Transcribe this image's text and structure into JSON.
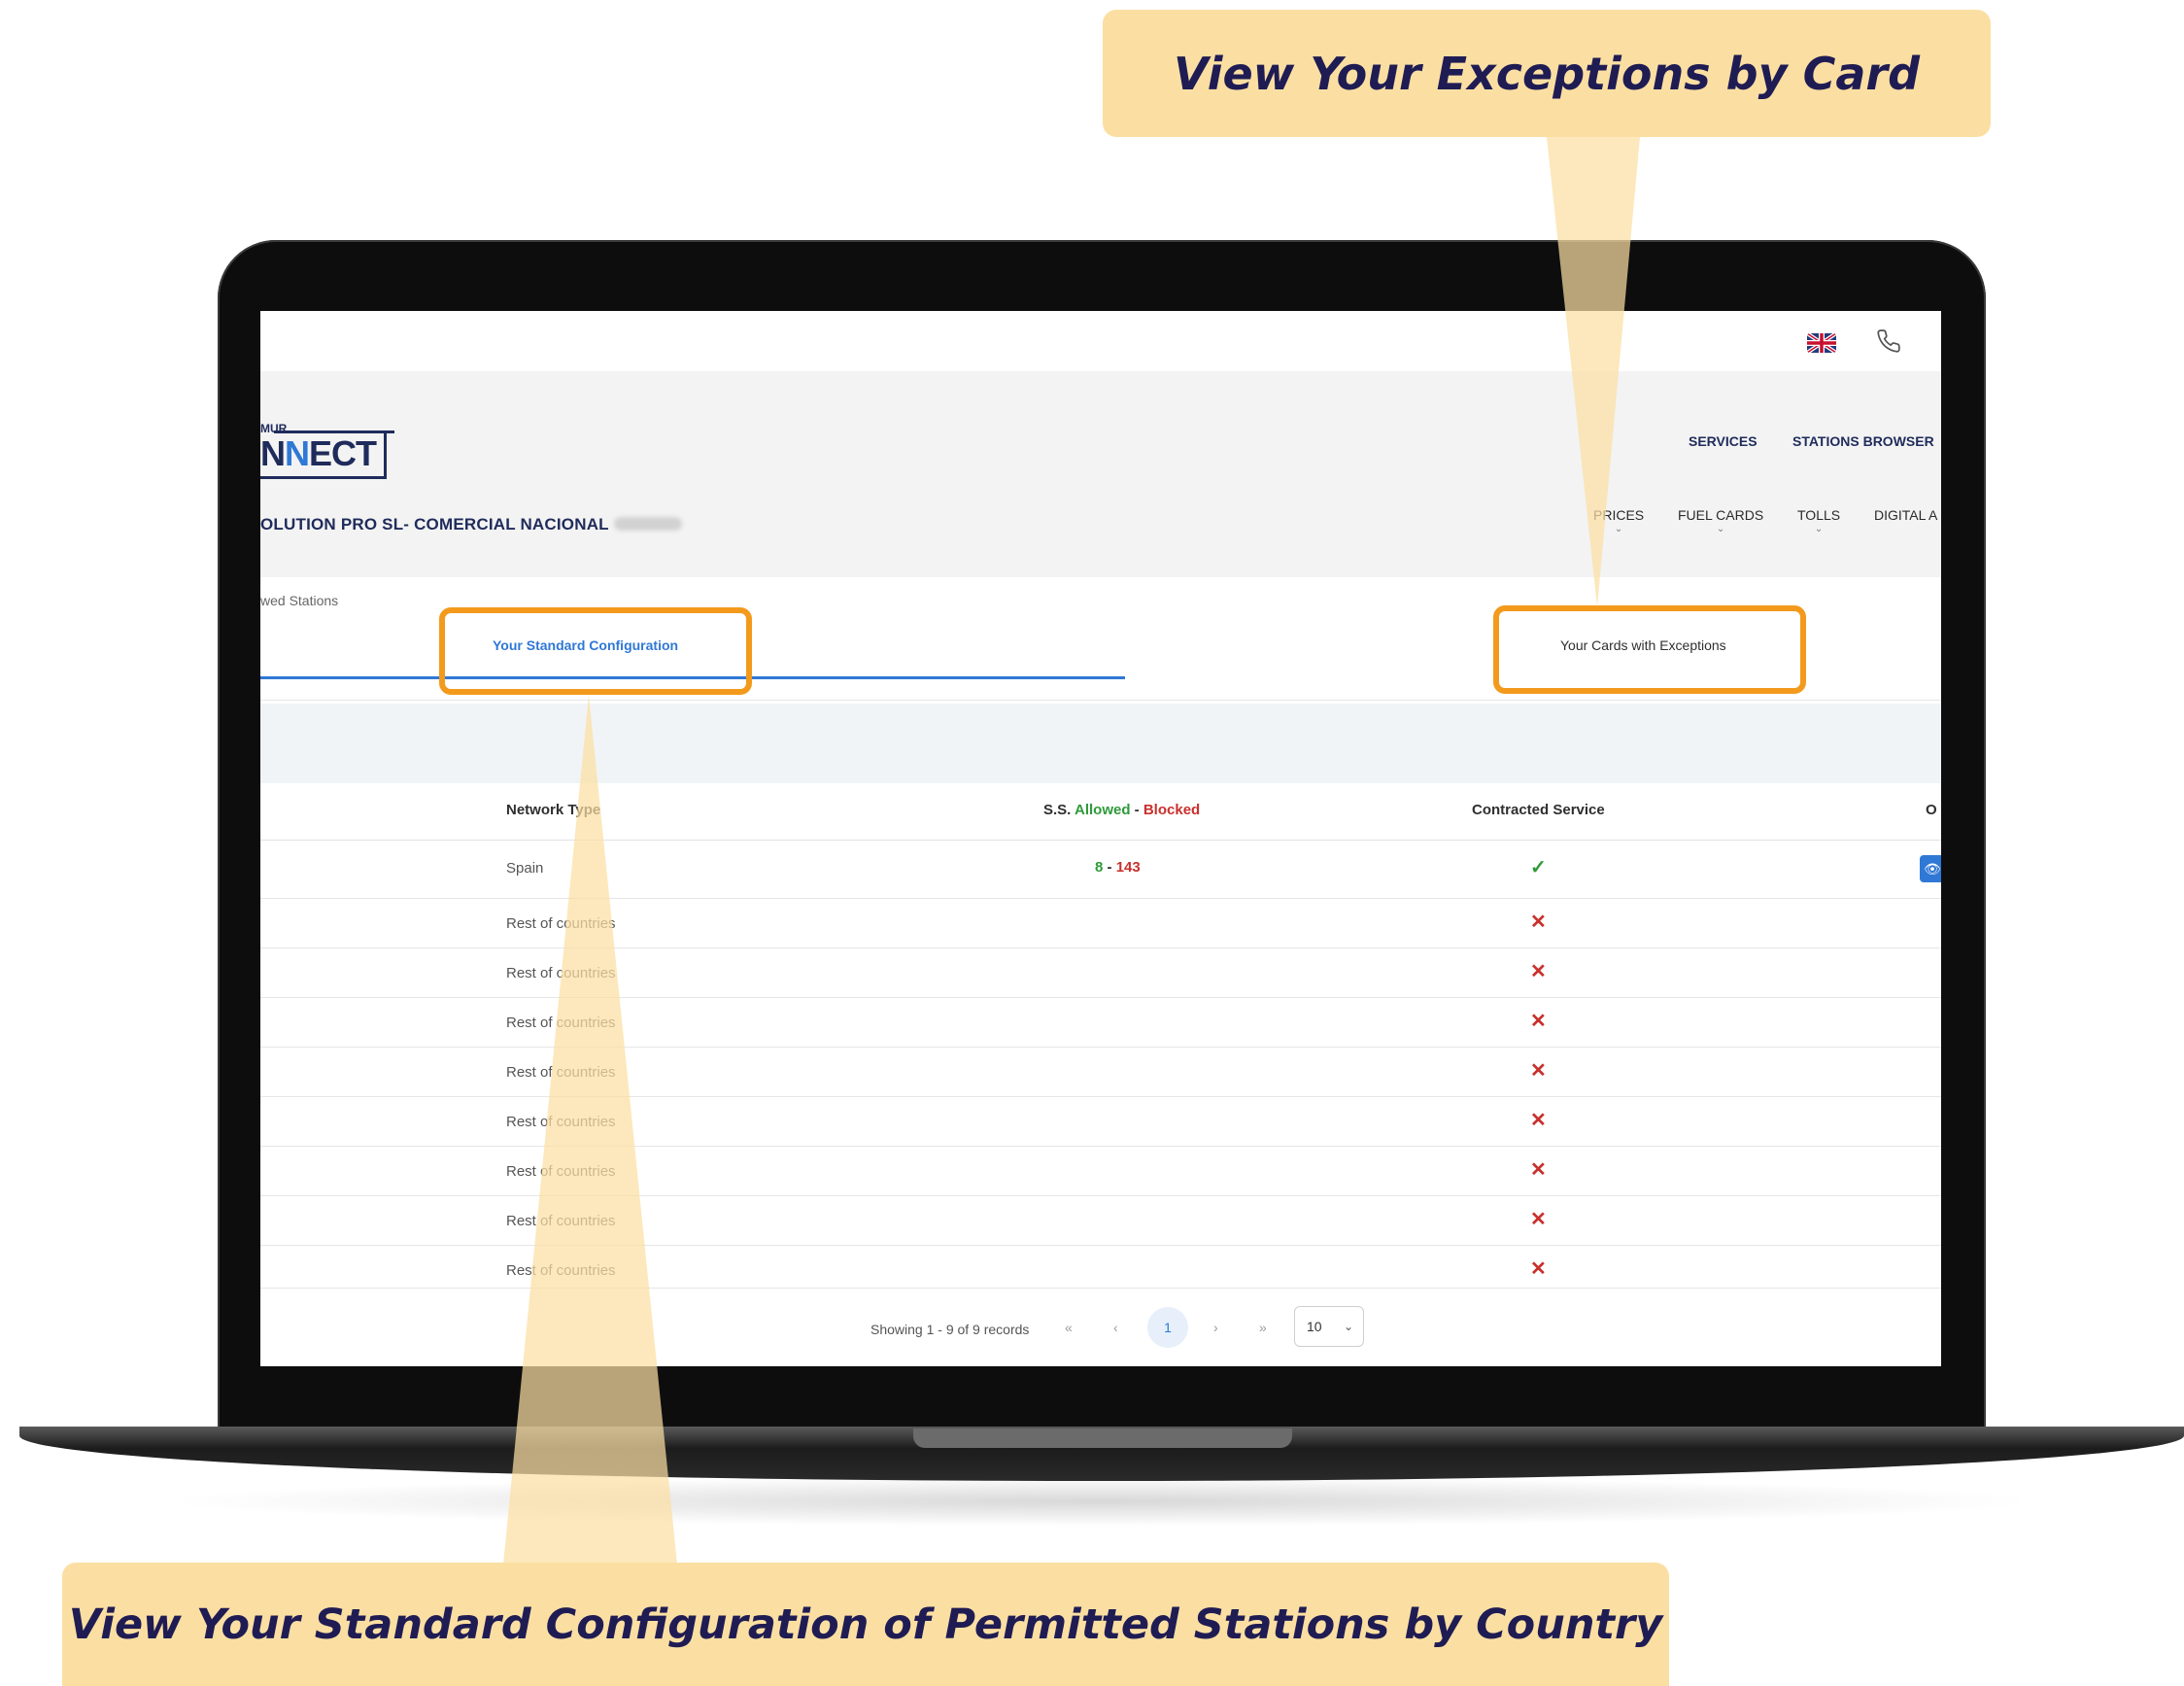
{
  "callouts": {
    "top": "View Your Exceptions by Card",
    "bottom": "View Your Standard Configuration of Permitted Stations by Country"
  },
  "header": {
    "logo_small": "MUR",
    "logo_dark1": "N",
    "logo_blue": "N",
    "logo_dark2": "ECT",
    "company": "OLUTION PRO SL- COMERCIAL NACIONAL",
    "flag_icon": "uk-flag-icon",
    "phone_icon": "phone-icon",
    "nav_primary": [
      "SERVICES",
      "STATIONS BROWSER"
    ],
    "nav_secondary": [
      "PRICES",
      "FUEL CARDS",
      "TOLLS",
      "DIGITAL A"
    ]
  },
  "breadcrumb": "wed Stations",
  "tabs": {
    "standard": "Your Standard Configuration",
    "exceptions": "Your Cards with Exceptions"
  },
  "table": {
    "columns": {
      "network": "Network Type",
      "ss_prefix": "S.S.",
      "ss_allowed": "Allowed",
      "ss_sep": " - ",
      "ss_blocked": "Blocked",
      "service": "Contracted Service",
      "options": "O"
    },
    "rows": [
      {
        "network": "Spain",
        "allowed": "8",
        "sep": " - ",
        "blocked": "143",
        "service": "✓",
        "view": "👁"
      },
      {
        "network": "Rest of countries",
        "service": "✕"
      },
      {
        "network": "Rest of countries",
        "service": "✕"
      },
      {
        "network": "Rest of countries",
        "service": "✕"
      },
      {
        "network": "Rest of countries",
        "service": "✕"
      },
      {
        "network": "Rest of countries",
        "service": "✕"
      },
      {
        "network": "Rest of countries",
        "service": "✕"
      },
      {
        "network": "Rest of countries",
        "service": "✕"
      },
      {
        "network": "Rest of countries",
        "service": "✕"
      }
    ]
  },
  "pagination": {
    "summary": "Showing 1 - 9 of 9 records",
    "first": "«",
    "prev": "‹",
    "current": "1",
    "next": "›",
    "last": "»",
    "page_size": "10",
    "page_size_chevron": "⌄"
  },
  "colors": {
    "callout_bg": "#fbdfa2",
    "callout_text": "#1f1c54",
    "highlight": "#f39a1d",
    "accent": "#2f78d6",
    "allowed": "#2e9a3a",
    "blocked": "#c9302c"
  }
}
